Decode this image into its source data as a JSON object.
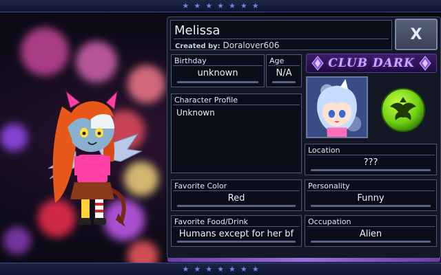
{
  "character": {
    "name": "Melissa",
    "created_by_label": "Created by:",
    "created_by": "Doralover606"
  },
  "close_button": {
    "label": "X"
  },
  "fields": {
    "birthday": {
      "label": "Birthday",
      "value": "unknown"
    },
    "age": {
      "label": "Age",
      "value": "N/A"
    },
    "profile": {
      "label": "Character Profile",
      "value": "Unknown"
    },
    "location": {
      "label": "Location",
      "value": "???"
    },
    "favorite_color": {
      "label": "Favorite Color",
      "value": "Red"
    },
    "personality": {
      "label": "Personality",
      "value": "Funny"
    },
    "favorite_food": {
      "label": "Favorite Food/Drink",
      "value": "Humans except for her bf"
    },
    "occupation": {
      "label": "Occupation",
      "value": "Alien"
    }
  },
  "club": {
    "name": "CLUB DARK",
    "icon": "club-avatar-icon",
    "emblem": "green-dragon-emblem-icon"
  },
  "decor": {
    "star_glyph": "★",
    "star_count": 7
  },
  "colors": {
    "panel_bg": "#141824",
    "field_bg": "#0b0e18",
    "border": "#4a5880",
    "club_text": "#c9a9ff",
    "emblem_green": "#7fe01a"
  }
}
